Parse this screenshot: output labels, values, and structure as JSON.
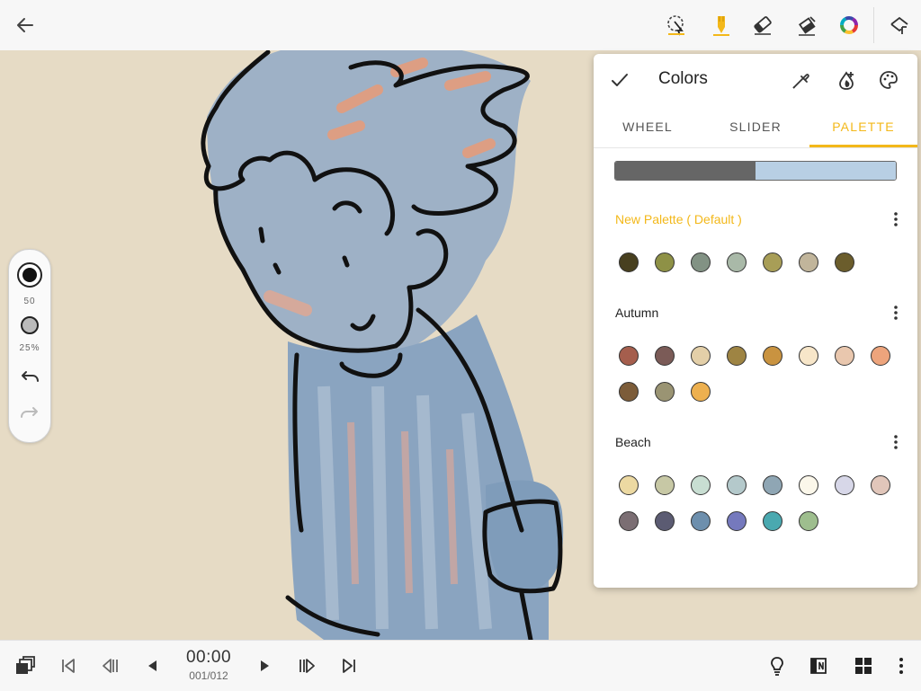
{
  "panel": {
    "title": "Colors",
    "tabs": [
      "WHEEL",
      "SLIDER",
      "PALETTE"
    ],
    "active_tab": "PALETTE",
    "preview_colors": [
      "#666666",
      "#b8cfe4"
    ],
    "palettes": [
      {
        "name": "New Palette ( Default )",
        "is_default": true,
        "colors": [
          "#48401f",
          "#8e9146",
          "#829284",
          "#a9b9a8",
          "#a89e57",
          "#c1b59b",
          "#6b5d2c"
        ]
      },
      {
        "name": "Autumn",
        "is_default": false,
        "colors": [
          "#a55e4d",
          "#7b5b57",
          "#e3cfa8",
          "#9e8443",
          "#c99340",
          "#f7e6c9",
          "#e9c7ae",
          "#eda47c",
          "#7c5c39",
          "#9a9473",
          "#edb04f"
        ]
      },
      {
        "name": "Beach",
        "is_default": false,
        "colors": [
          "#ecd9a2",
          "#c7c8a5",
          "#c8ded2",
          "#b4c9cb",
          "#8fa6b4",
          "#fbf7ea",
          "#d7d7e8",
          "#e1c6ba",
          "#7b6e73",
          "#5b5b72",
          "#6d8fad",
          "#7579bd",
          "#4aa9b0",
          "#9ebe8e"
        ]
      }
    ]
  },
  "brush_panel": {
    "size_label": "50",
    "opacity_label": "25%"
  },
  "bottom_bar": {
    "time": "00:00",
    "frame": "001/012"
  },
  "accent_color": "#f3b81a",
  "icons": {
    "top": [
      "back-arrow-icon",
      "lasso-select-icon",
      "brush-icon",
      "eraser-icon",
      "paint-bucket-icon",
      "color-wheel-icon",
      "layers-undo-icon"
    ],
    "bottom": [
      "layers-stack-icon",
      "first-frame-icon",
      "previous-keyframe-icon",
      "previous-frame-icon",
      "next-frame-icon",
      "next-keyframe-icon",
      "last-frame-icon",
      "onion-skin-icon",
      "notebook-icon",
      "grid-view-icon",
      "more-vertical-icon"
    ]
  }
}
